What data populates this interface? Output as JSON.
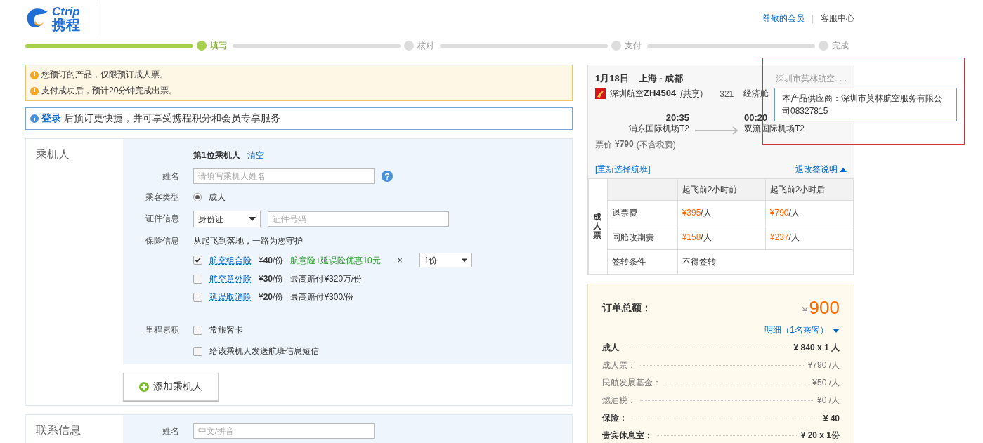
{
  "header": {
    "logo_latin": "Ctrip",
    "logo_cjk": "携程",
    "links": [
      {
        "label": "尊敬的会员",
        "kind": "link"
      },
      {
        "label": "客服中心",
        "kind": "plain"
      }
    ],
    "separator": "|"
  },
  "steps": [
    {
      "label": "填写",
      "selected": true
    },
    {
      "label": "核对",
      "selected": false
    },
    {
      "label": "支付",
      "selected": false
    },
    {
      "label": "完成",
      "selected": false
    }
  ],
  "notices": [
    "您预订的产品，仅限预订成人票。",
    "支付成功后，预计20分钟完成出票。"
  ],
  "login_bar": {
    "link": "登录",
    "text": "后预订更快捷，并可享受携程积分和会员专享服务"
  },
  "passenger": {
    "title": "乘机人",
    "subtitle": "第1位乘机人",
    "clear": "清空",
    "name": {
      "label": "姓名",
      "placeholder": "请填写乘机人姓名"
    },
    "type": {
      "label": "乘客类型",
      "option": "成人",
      "selected": true
    },
    "id": {
      "label": "证件信息",
      "select": "身份证",
      "placeholder": "证件号码"
    },
    "insurance": {
      "label": "保险信息",
      "intro": "从起飞到落地，一路为您守护",
      "items": [
        {
          "name": "航空组合险",
          "price": "¥**40**/份",
          "note": "航意险+延误险优惠10元",
          "kind": "promo",
          "times": "×",
          "qty": "1份",
          "checked": true
        },
        {
          "name": "航空意外险",
          "price": "¥**30**/份",
          "note": "最高赔付¥320万/份",
          "kind": "plain",
          "checked": false
        },
        {
          "name": "延误取消险",
          "price": "¥**20**/份",
          "note": "最高赔付¥300/份",
          "kind": "plain",
          "checked": false
        }
      ]
    },
    "mileage": {
      "label": "里程累积",
      "option": "常旅客卡",
      "checked": false
    },
    "sms": {
      "option": "给该乘机人发送航班信息短信",
      "checked": false
    },
    "add_button": "添加乘机人"
  },
  "contact": {
    "title": "联系信息",
    "name_label": "姓名",
    "placeholder": "中文/拼音"
  },
  "flight": {
    "date": "1月18日",
    "route": "上海 - 成都",
    "supplier": "深圳市莫林航空. . .",
    "airline": "深圳航空",
    "flight_no": "ZH4504",
    "share": "(共享)",
    "aircraft": "321",
    "cabin": "经济舱",
    "dep_time": "20:35",
    "dep_airport": "浦东国际机场T2",
    "arr_time": "00:20",
    "arr_airport": "双流国际机场T2",
    "price_label": "票价",
    "price": "¥**790**",
    "tax": "(不含税费)",
    "rebook": "[重新选择航班]",
    "rules_link": "退改签说明"
  },
  "rules": {
    "side": "成人票",
    "columns": [
      "起飞前2小时前",
      "起飞前2小时后"
    ],
    "rows": [
      {
        "label": "退票费",
        "cells": [
          "¥395/人",
          "¥790/人"
        ],
        "kind": "fee"
      },
      {
        "label": "同舱改期费",
        "cells": [
          "¥158/人",
          "¥237/人"
        ],
        "kind": "fee"
      },
      {
        "label": "签转条件",
        "cells": [
          "不得签转"
        ],
        "kind": "text"
      }
    ]
  },
  "tooltip": {
    "text": "本产品供应商：深圳市莫林航空服务有限公司08327815"
  },
  "total": {
    "label": "订单总额：",
    "currency": "¥",
    "amount": "900",
    "detail": "明细（1名乘客）",
    "lines": [
      {
        "label": "成人",
        "value": "¥ 840 x 1 人",
        "kind": "main"
      },
      {
        "label": "成人票：",
        "value": "¥790 /人",
        "kind": "sub"
      },
      {
        "label": "民航发展基金：",
        "value": "¥50 /人",
        "kind": "sub"
      },
      {
        "label": "燃油税：",
        "value": "¥0 /人",
        "kind": "sub"
      },
      {
        "label": "保险：",
        "value": "¥ 40",
        "kind": "main"
      },
      {
        "label": "贵宾休息室：",
        "value": "¥ 20 x 1份",
        "kind": "main"
      }
    ]
  }
}
